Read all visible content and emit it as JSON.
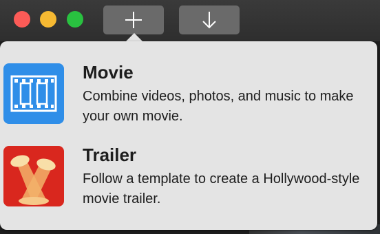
{
  "toolbar": {
    "window_controls": [
      "close",
      "minimize",
      "zoom"
    ],
    "new_button_icon": "plus-icon",
    "import_button_icon": "arrow-down-icon"
  },
  "popover": {
    "options": [
      {
        "title": "Movie",
        "description": "Combine videos, photos, and music to make your own movie.",
        "icon": "film-strip-icon",
        "icon_color": "#2f8ee8"
      },
      {
        "title": "Trailer",
        "description": "Follow a template to create a Hollywood-style movie trailer.",
        "icon": "spotlights-icon",
        "icon_color": "#d9271e"
      }
    ]
  },
  "colors": {
    "close": "#fc5b57",
    "minimize": "#f6b932",
    "zoom": "#29c140",
    "popover_bg": "#e4e4e4"
  }
}
